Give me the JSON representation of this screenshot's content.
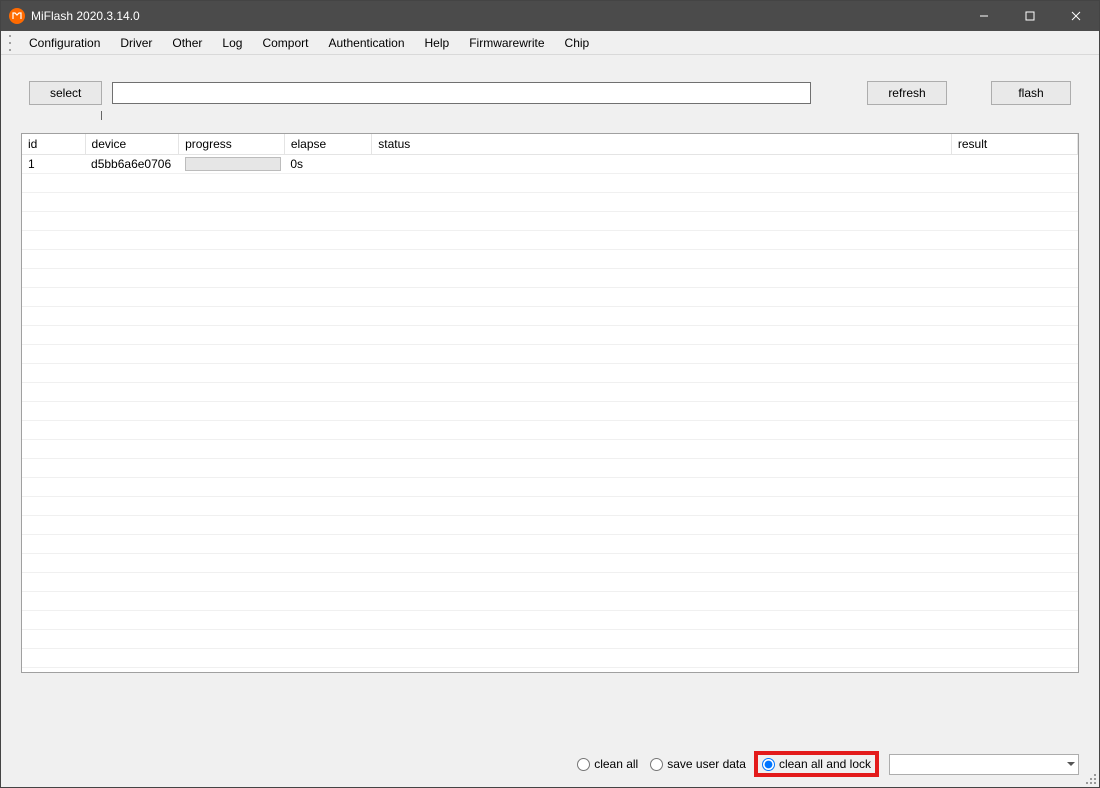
{
  "title": "MiFlash 2020.3.14.0",
  "menu": [
    "Configuration",
    "Driver",
    "Other",
    "Log",
    "Comport",
    "Authentication",
    "Help",
    "Firmwarewrite",
    "Chip"
  ],
  "toolbar": {
    "select_label": "select",
    "refresh_label": "refresh",
    "flash_label": "flash",
    "path_value": ""
  },
  "columns": {
    "id": "id",
    "device": "device",
    "progress": "progress",
    "elapse": "elapse",
    "status": "status",
    "result": "result"
  },
  "rows": [
    {
      "id": "1",
      "device": "d5bb6a6e0706",
      "elapse": "0s",
      "status": "",
      "result": ""
    }
  ],
  "options": {
    "clean_all": "clean all",
    "save_user_data": "save user data",
    "clean_all_and_lock": "clean all and lock",
    "selected": "clean_all_and_lock"
  }
}
